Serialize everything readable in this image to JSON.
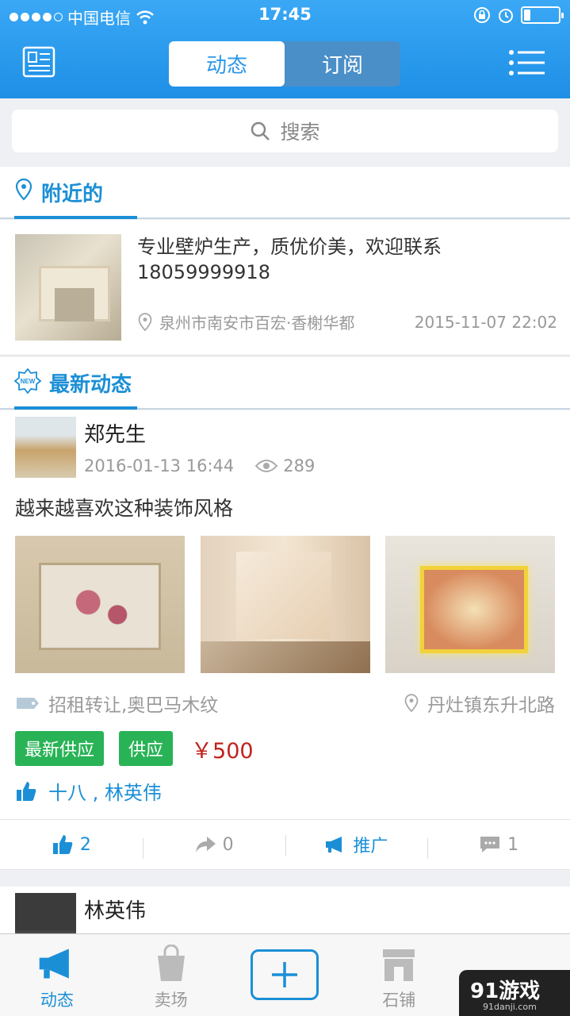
{
  "status": {
    "carrier": "中国电信",
    "time": "17:45",
    "battery_level": 0.2
  },
  "header": {
    "tabs": [
      {
        "label": "动态",
        "active": true
      },
      {
        "label": "订阅",
        "active": false
      }
    ]
  },
  "search": {
    "placeholder": "搜索"
  },
  "nearby": {
    "title": "附近的",
    "item": {
      "description": "专业壁炉生产，质优价美，欢迎联系18059999918",
      "location": "泉州市南安市百宏·香榭华都",
      "time": "2015-11-07 22:02"
    }
  },
  "latest": {
    "title": "最新动态",
    "post": {
      "user": "郑先生",
      "time": "2016-01-13 16:44",
      "views": "289",
      "text": "越来越喜欢这种装饰风格",
      "tags": "招租转让,奥巴马木纹",
      "location": "丹灶镇东升北路",
      "badges": [
        "最新供应",
        "供应"
      ],
      "price": "￥500",
      "likes": "十八 , 林英伟"
    },
    "actions": [
      {
        "icon": "thumbs-up-icon",
        "count": "2"
      },
      {
        "icon": "share-icon",
        "count": "0"
      },
      {
        "icon": "megaphone-icon",
        "label": "推广"
      },
      {
        "icon": "comment-icon",
        "count": "1"
      }
    ],
    "next_post": {
      "user": "林英伟"
    }
  },
  "tabbar": [
    {
      "label": "动态",
      "active": true
    },
    {
      "label": "卖场"
    },
    {
      "label": ""
    },
    {
      "label": "石铺"
    },
    {
      "label": ""
    }
  ],
  "watermark": {
    "text": "91游戏",
    "url": "91danji.com"
  },
  "colors": {
    "primary": "#1b8fd6",
    "green": "#29b356",
    "price": "#c0221f"
  }
}
